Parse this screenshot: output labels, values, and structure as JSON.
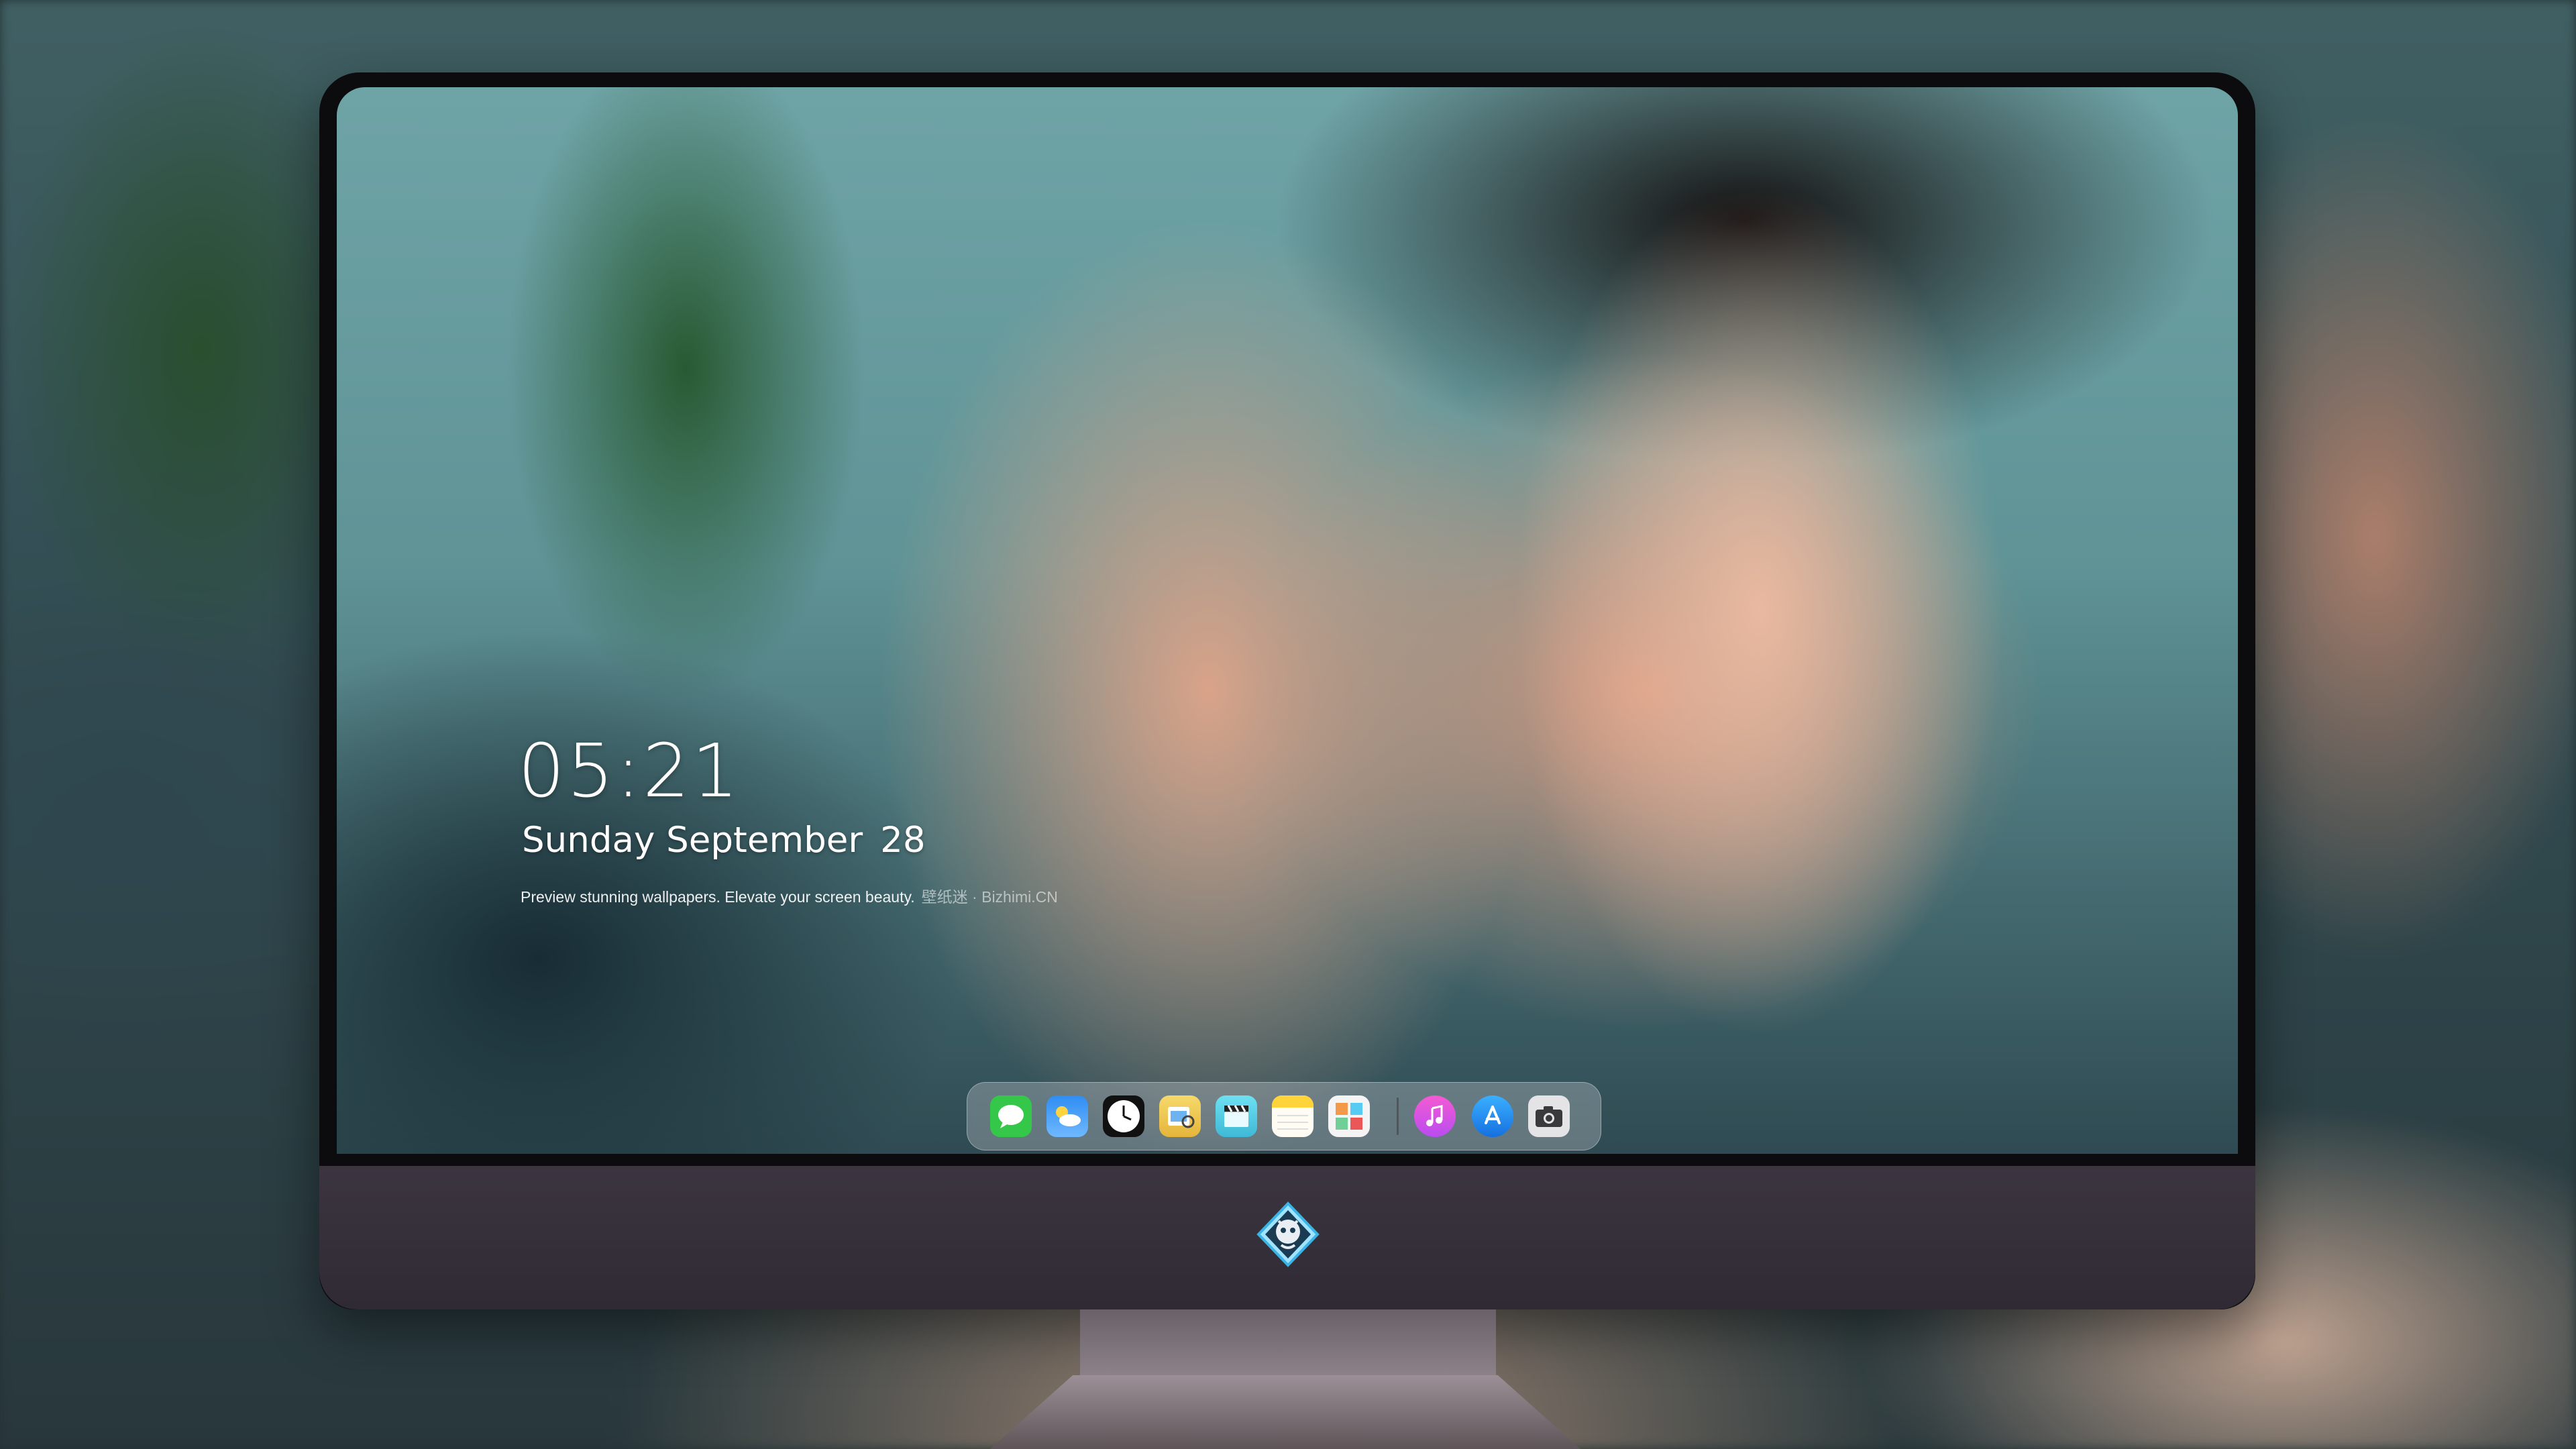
{
  "lock_screen": {
    "time": "05:21",
    "weekday_month": "Sunday September",
    "day": "28",
    "caption": "Preview stunning wallpapers. Elevate your screen beauty.",
    "caption_brand": "壁纸迷 · Bizhimi.CN"
  },
  "dock": {
    "apps": [
      {
        "name": "Messages",
        "icon": "messages-icon",
        "color": "#3ad24f"
      },
      {
        "name": "Weather",
        "icon": "weather-icon",
        "color": "#2f8df2"
      },
      {
        "name": "Clock",
        "icon": "clock-icon",
        "color": "#111111"
      },
      {
        "name": "Preview",
        "icon": "preview-icon",
        "color": "#f2c94c"
      },
      {
        "name": "Final Cut",
        "icon": "clapper-icon",
        "color": "#5ad1e8"
      },
      {
        "name": "Notes",
        "icon": "notes-icon",
        "color": "#ffd94a"
      },
      {
        "name": "Photo Booth",
        "icon": "photo-grid-icon",
        "color": "#ffffff"
      },
      {
        "name": "iTunes",
        "icon": "music-note-icon",
        "color": "#e85bd6"
      },
      {
        "name": "App Store",
        "icon": "app-store-icon",
        "color": "#1d8cf2"
      },
      {
        "name": "Camera",
        "icon": "camera-icon",
        "color": "#3a3a3c"
      }
    ]
  },
  "device": {
    "logo": "dragon-emblem-icon"
  }
}
